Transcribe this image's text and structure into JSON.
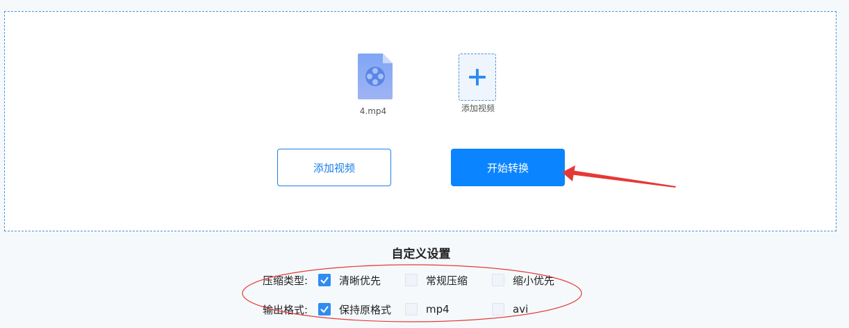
{
  "files": [
    {
      "name": "4.mp4",
      "icon": "video-file-icon"
    }
  ],
  "add_tile": {
    "label": "添加视频",
    "icon": "plus-icon"
  },
  "buttons": {
    "add_video": "添加视频",
    "start_convert": "开始转换"
  },
  "settings": {
    "title": "自定义设置",
    "compression": {
      "label": "压缩类型:",
      "options": [
        {
          "label": "清晰优先",
          "checked": true
        },
        {
          "label": "常规压缩",
          "checked": false
        },
        {
          "label": "缩小优先",
          "checked": false
        }
      ]
    },
    "output_format": {
      "label": "输出格式:",
      "options": [
        {
          "label": "保持原格式",
          "checked": true
        },
        {
          "label": "mp4",
          "checked": false
        },
        {
          "label": "avi",
          "checked": false
        }
      ]
    }
  },
  "colors": {
    "accent": "#0b84ff",
    "annotation": "#e53935",
    "border": "#4a90d9"
  }
}
